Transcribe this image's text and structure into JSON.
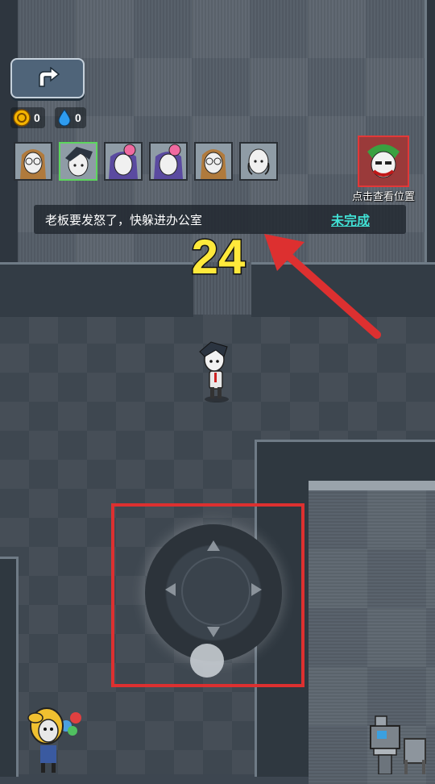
{
  "hud": {
    "back_icon": "u-turn-arrow-icon",
    "coins": "0",
    "drops": "0",
    "characters": [
      {
        "name": "girl-glasses-1",
        "selected": false
      },
      {
        "name": "boy-dark-hair",
        "selected": true
      },
      {
        "name": "girl-pink-bow-1",
        "selected": false
      },
      {
        "name": "girl-pink-bow-2",
        "selected": false
      },
      {
        "name": "girl-glasses-2",
        "selected": false
      },
      {
        "name": "bald-man",
        "selected": false
      }
    ],
    "boss_label": "点击查看位置",
    "task_text": "老板要发怒了，快躲进办公室",
    "task_status": "未完成",
    "countdown": "24"
  },
  "colors": {
    "task_status": "#41e0d4",
    "countdown": "#ffe93b",
    "annotation": "#dd3030",
    "selected_border": "#5dd65d"
  }
}
